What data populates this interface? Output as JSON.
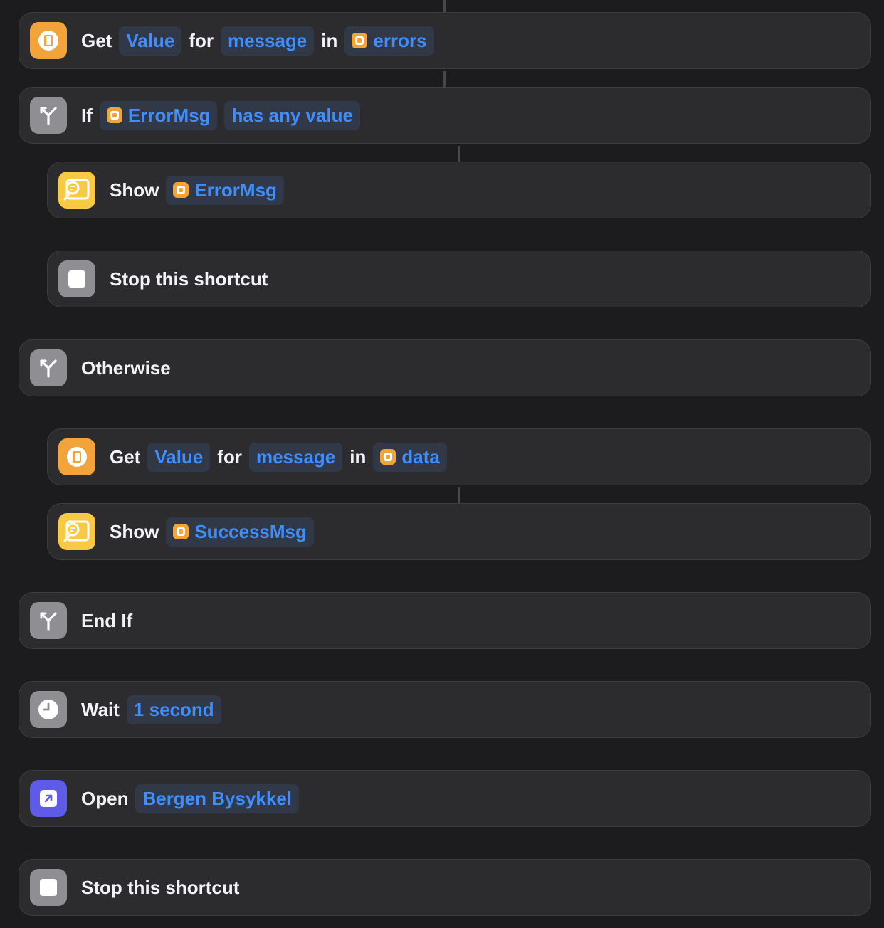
{
  "actions": [
    {
      "words": [
        "Get",
        "for",
        "in"
      ],
      "tokens": [
        "Value",
        "message",
        "errors"
      ]
    },
    {
      "words": [
        "If"
      ],
      "tokens": [
        "ErrorMsg",
        "has any value"
      ]
    },
    {
      "words": [
        "Show"
      ],
      "tokens": [
        "ErrorMsg"
      ]
    },
    {
      "words": [
        "Stop this shortcut"
      ]
    },
    {
      "words": [
        "Otherwise"
      ]
    },
    {
      "words": [
        "Get",
        "for",
        "in"
      ],
      "tokens": [
        "Value",
        "message",
        "data"
      ]
    },
    {
      "words": [
        "Show"
      ],
      "tokens": [
        "SuccessMsg"
      ]
    },
    {
      "words": [
        "End If"
      ]
    },
    {
      "words": [
        "Wait"
      ],
      "tokens": [
        "1 second"
      ]
    },
    {
      "words": [
        "Open"
      ],
      "tokens": [
        "Bergen Bysykkel"
      ]
    },
    {
      "words": [
        "Stop this shortcut"
      ]
    }
  ],
  "icons": {
    "get": "dictionary-icon",
    "if": "branch-icon",
    "show": "quick-look-icon",
    "stop": "stop-icon",
    "wait": "clock-icon",
    "open": "open-app-icon",
    "variable": "variable-icon"
  },
  "colors": {
    "background": "#1c1c1e",
    "card": "#2c2c2e",
    "token_text": "#3f8efc",
    "token_bg": "#313848",
    "orange": "#f2a33a",
    "yellow": "#f7c945",
    "gray": "#8e8e93",
    "purple": "#5e5ce6"
  }
}
